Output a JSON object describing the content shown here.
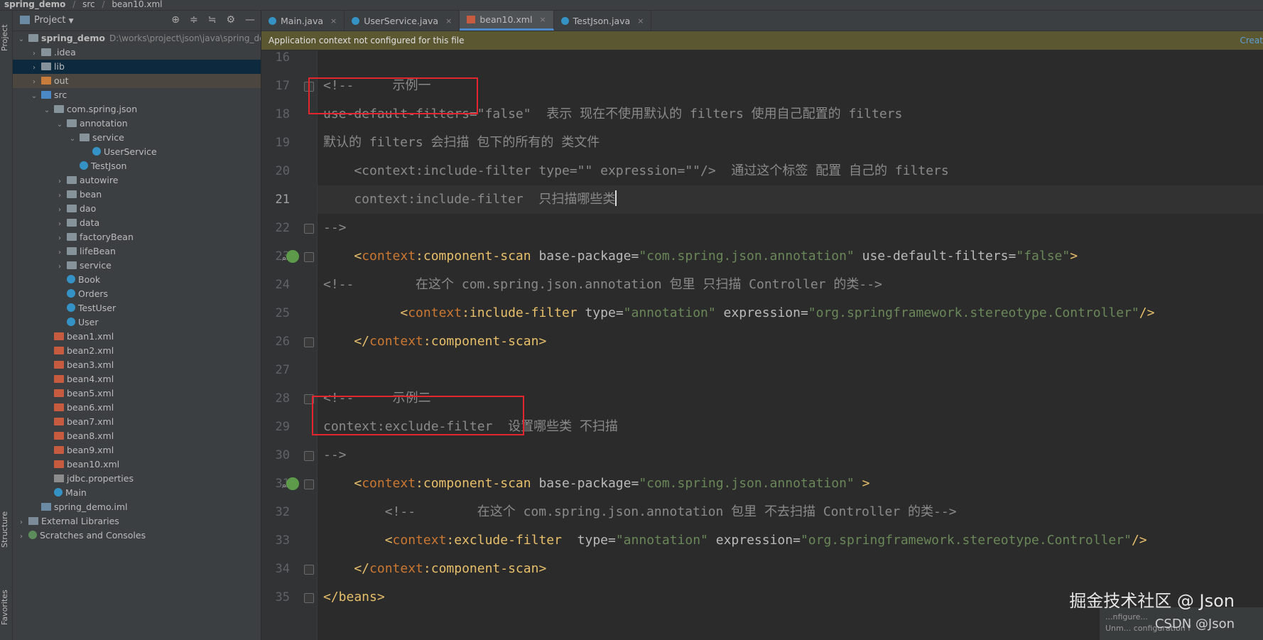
{
  "breadcrumb": {
    "project": "spring_demo",
    "folder": "src",
    "file": "bean10.xml"
  },
  "side_tabs": {
    "project": "Project",
    "structure": "Structure",
    "favorites": "Favorites"
  },
  "project_panel": {
    "title": "Project",
    "tree": [
      {
        "label": "spring_demo",
        "path": "D:\\works\\project\\json\\java\\spring_der",
        "icon": "module-folder",
        "depth": 0,
        "expanded": true
      },
      {
        "label": ".idea",
        "icon": "folder",
        "depth": 1,
        "expanded": false
      },
      {
        "label": "lib",
        "icon": "folder",
        "depth": 1,
        "expanded": false,
        "state": "selected"
      },
      {
        "label": "out",
        "icon": "folder-orange",
        "depth": 1,
        "expanded": false,
        "state": "highlight"
      },
      {
        "label": "src",
        "icon": "folder-blue",
        "depth": 1,
        "expanded": true
      },
      {
        "label": "com.spring.json",
        "icon": "package",
        "depth": 2,
        "expanded": true
      },
      {
        "label": "annotation",
        "icon": "package",
        "depth": 3,
        "expanded": true
      },
      {
        "label": "service",
        "icon": "package",
        "depth": 4,
        "expanded": true
      },
      {
        "label": "UserService",
        "icon": "class",
        "depth": 5
      },
      {
        "label": "TestJson",
        "icon": "class",
        "depth": 4
      },
      {
        "label": "autowire",
        "icon": "package",
        "depth": 3,
        "expanded": false
      },
      {
        "label": "bean",
        "icon": "package",
        "depth": 3,
        "expanded": false
      },
      {
        "label": "dao",
        "icon": "package",
        "depth": 3,
        "expanded": false
      },
      {
        "label": "data",
        "icon": "package",
        "depth": 3,
        "expanded": false
      },
      {
        "label": "factoryBean",
        "icon": "package",
        "depth": 3,
        "expanded": false
      },
      {
        "label": "lifeBean",
        "icon": "package",
        "depth": 3,
        "expanded": false
      },
      {
        "label": "service",
        "icon": "package",
        "depth": 3,
        "expanded": false
      },
      {
        "label": "Book",
        "icon": "class",
        "depth": 3
      },
      {
        "label": "Orders",
        "icon": "class",
        "depth": 3
      },
      {
        "label": "TestUser",
        "icon": "class",
        "depth": 3
      },
      {
        "label": "User",
        "icon": "class",
        "depth": 3
      },
      {
        "label": "bean1.xml",
        "icon": "xml",
        "depth": 2
      },
      {
        "label": "bean2.xml",
        "icon": "xml",
        "depth": 2
      },
      {
        "label": "bean3.xml",
        "icon": "xml",
        "depth": 2
      },
      {
        "label": "bean4.xml",
        "icon": "xml",
        "depth": 2
      },
      {
        "label": "bean5.xml",
        "icon": "xml",
        "depth": 2
      },
      {
        "label": "bean6.xml",
        "icon": "xml",
        "depth": 2
      },
      {
        "label": "bean7.xml",
        "icon": "xml",
        "depth": 2
      },
      {
        "label": "bean8.xml",
        "icon": "xml",
        "depth": 2
      },
      {
        "label": "bean9.xml",
        "icon": "xml",
        "depth": 2
      },
      {
        "label": "bean10.xml",
        "icon": "xml",
        "depth": 2
      },
      {
        "label": "jdbc.properties",
        "icon": "properties",
        "depth": 2
      },
      {
        "label": "Main",
        "icon": "class",
        "depth": 2
      },
      {
        "label": "spring_demo.iml",
        "icon": "module",
        "depth": 1
      },
      {
        "label": "External Libraries",
        "icon": "libraries",
        "depth": 0,
        "expanded": false
      },
      {
        "label": "Scratches and Consoles",
        "icon": "scratches",
        "depth": 0,
        "expanded": false
      }
    ]
  },
  "tabs": [
    {
      "label": "Main.java",
      "icon": "class",
      "active": false
    },
    {
      "label": "UserService.java",
      "icon": "class",
      "active": false
    },
    {
      "label": "bean10.xml",
      "icon": "xml",
      "active": true
    },
    {
      "label": "TestJson.java",
      "icon": "class",
      "active": false
    }
  ],
  "banner": {
    "message": "Application context not configured for this file",
    "action": "Creat"
  },
  "editor": {
    "current_line": "21",
    "lines": [
      {
        "no": "16",
        "segs": []
      },
      {
        "no": "17",
        "segs": [
          {
            "t": "<!--     示例一",
            "c": "cm"
          }
        ]
      },
      {
        "no": "18",
        "segs": [
          {
            "t": "use-default-filters=\"false\"  表示 现在不使用默认的 filters 使用自己配置的 filters",
            "c": "cm"
          }
        ]
      },
      {
        "no": "19",
        "segs": [
          {
            "t": "默认的 filters 会扫描 包下的所有的 类文件",
            "c": "cm"
          }
        ]
      },
      {
        "no": "20",
        "segs": [
          {
            "t": "    <context:include-filter type=\"\" expression=\"\"/>  通过这个标签 配置 自己的 filters",
            "c": "cm"
          }
        ]
      },
      {
        "no": "21",
        "segs": [
          {
            "t": "    context:include-filter  只扫描哪些类",
            "c": "cm"
          }
        ]
      },
      {
        "no": "22",
        "segs": [
          {
            "t": "-->",
            "c": "cm"
          }
        ]
      },
      {
        "no": "23",
        "segs": [
          {
            "t": "    <",
            "c": "tag"
          },
          {
            "t": "context",
            "c": "ns"
          },
          {
            "t": ":component-scan ",
            "c": "tag"
          },
          {
            "t": "base-package",
            "c": "attr"
          },
          {
            "t": "=",
            "c": "pun"
          },
          {
            "t": "\"com.spring.json.annotation\"",
            "c": "val"
          },
          {
            "t": " use-default-filters",
            "c": "attr"
          },
          {
            "t": "=",
            "c": "pun"
          },
          {
            "t": "\"false\"",
            "c": "val"
          },
          {
            "t": ">",
            "c": "tag"
          }
        ]
      },
      {
        "no": "24",
        "segs": [
          {
            "t": "<!--        在这个 com.spring.json.annotation 包里 只扫描 Controller 的类-->",
            "c": "cm"
          }
        ]
      },
      {
        "no": "25",
        "segs": [
          {
            "t": "          <",
            "c": "tag"
          },
          {
            "t": "context",
            "c": "ns"
          },
          {
            "t": ":include-filter ",
            "c": "tag"
          },
          {
            "t": "type",
            "c": "attr"
          },
          {
            "t": "=",
            "c": "pun"
          },
          {
            "t": "\"annotation\"",
            "c": "val"
          },
          {
            "t": " expression",
            "c": "attr"
          },
          {
            "t": "=",
            "c": "pun"
          },
          {
            "t": "\"org.springframework.stereotype.Controller\"",
            "c": "val"
          },
          {
            "t": "/>",
            "c": "tag"
          }
        ]
      },
      {
        "no": "26",
        "segs": [
          {
            "t": "    </",
            "c": "tag"
          },
          {
            "t": "context",
            "c": "ns"
          },
          {
            "t": ":component-scan>",
            "c": "tag"
          }
        ]
      },
      {
        "no": "27",
        "segs": []
      },
      {
        "no": "28",
        "segs": [
          {
            "t": "<!--     示例二",
            "c": "cm"
          }
        ]
      },
      {
        "no": "29",
        "segs": [
          {
            "t": "context:exclude-filter  设置哪些类 不扫描",
            "c": "cm"
          }
        ]
      },
      {
        "no": "30",
        "segs": [
          {
            "t": "-->",
            "c": "cm"
          }
        ]
      },
      {
        "no": "31",
        "segs": [
          {
            "t": "    <",
            "c": "tag"
          },
          {
            "t": "context",
            "c": "ns"
          },
          {
            "t": ":component-scan ",
            "c": "tag"
          },
          {
            "t": "base-package",
            "c": "attr"
          },
          {
            "t": "=",
            "c": "pun"
          },
          {
            "t": "\"com.spring.json.annotation\"",
            "c": "val"
          },
          {
            "t": " >",
            "c": "tag"
          }
        ]
      },
      {
        "no": "32",
        "segs": [
          {
            "t": "        <!--        在这个 com.spring.json.annotation 包里 不去扫描 Controller 的类-->",
            "c": "cm"
          }
        ]
      },
      {
        "no": "33",
        "segs": [
          {
            "t": "        <",
            "c": "tag"
          },
          {
            "t": "context",
            "c": "ns"
          },
          {
            "t": ":exclude-filter  ",
            "c": "tag"
          },
          {
            "t": "type",
            "c": "attr"
          },
          {
            "t": "=",
            "c": "pun"
          },
          {
            "t": "\"annotation\"",
            "c": "val"
          },
          {
            "t": " expression",
            "c": "attr"
          },
          {
            "t": "=",
            "c": "pun"
          },
          {
            "t": "\"org.springframework.stereotype.Controller\"",
            "c": "val"
          },
          {
            "t": "/>",
            "c": "tag"
          }
        ]
      },
      {
        "no": "34",
        "segs": [
          {
            "t": "    </",
            "c": "tag"
          },
          {
            "t": "context",
            "c": "ns"
          },
          {
            "t": ":component-scan>",
            "c": "tag"
          }
        ]
      },
      {
        "no": "35",
        "segs": [
          {
            "t": "</beans>",
            "c": "tag"
          }
        ]
      }
    ]
  },
  "watermark": {
    "line1": "掘金技术社区 @ Json",
    "line2": "CSDN @Json"
  },
  "notification": {
    "line1": "...nfigure...",
    "line2": "Unm... configuration f"
  },
  "colors": {
    "tag": "#e8bf6a",
    "namespace": "#cc7832",
    "attr": "#bababa",
    "string": "#6a8759",
    "comment": "#8a8a8a",
    "annotation_box": "#e3262d",
    "selection": "#0d293e",
    "banner": "#5b5731"
  }
}
